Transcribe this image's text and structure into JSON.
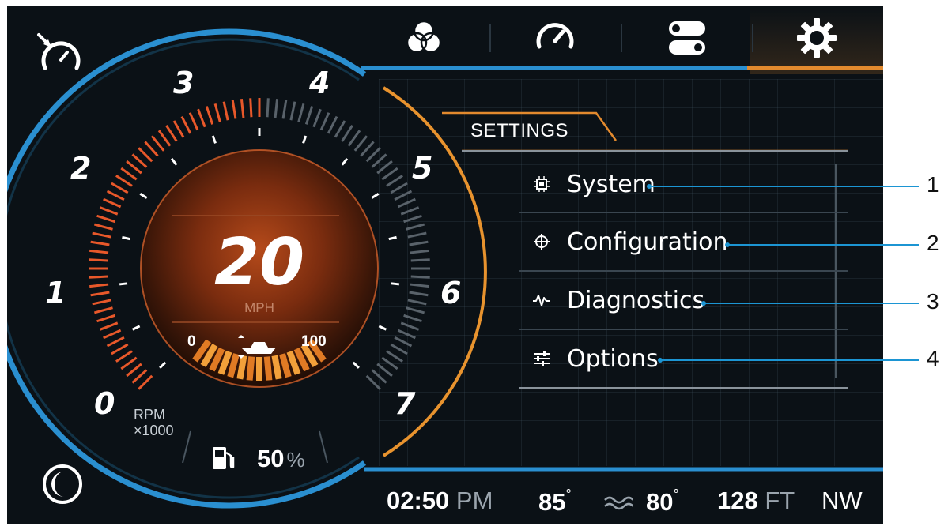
{
  "top_nav": {
    "tabs": [
      {
        "icon": "color-circles-icon",
        "active": false
      },
      {
        "icon": "speedometer-icon",
        "active": false
      },
      {
        "icon": "toggles-icon",
        "active": false
      },
      {
        "icon": "gear-icon",
        "active": true
      }
    ],
    "accent_color": "#e38a2e"
  },
  "gauge": {
    "rpm_ticks": [
      "0",
      "1",
      "2",
      "3",
      "4",
      "5",
      "6",
      "7"
    ],
    "rpm_unit_line1": "RPM",
    "rpm_unit_line2": "×1000",
    "speed_value": "20",
    "speed_unit": "MPH",
    "trim_min": "0",
    "trim_max": "100",
    "fuel_value": "50",
    "fuel_unit": "%",
    "rpm_level_fraction": 0.5,
    "colors": {
      "ring": "#2a8fd0",
      "rpm": "#e8582a",
      "arc": "#e8932e"
    }
  },
  "settings": {
    "title": "SETTINGS",
    "items": [
      {
        "label": "System",
        "icon": "chip-icon"
      },
      {
        "label": "Configuration",
        "icon": "crosshair-icon"
      },
      {
        "label": "Diagnostics",
        "icon": "waveform-icon"
      },
      {
        "label": "Options",
        "icon": "sliders-icon"
      }
    ]
  },
  "callouts": [
    "1",
    "2",
    "3",
    "4"
  ],
  "status_bar": {
    "time": "02:50",
    "ampm": "PM",
    "air_temp": "85",
    "water_temp": "80",
    "depth": "128",
    "depth_unit": "FT",
    "heading": "NW",
    "degree": "°"
  },
  "left_icons": {
    "top": "speedometer-alert-icon",
    "bottom": "moon-icon"
  }
}
